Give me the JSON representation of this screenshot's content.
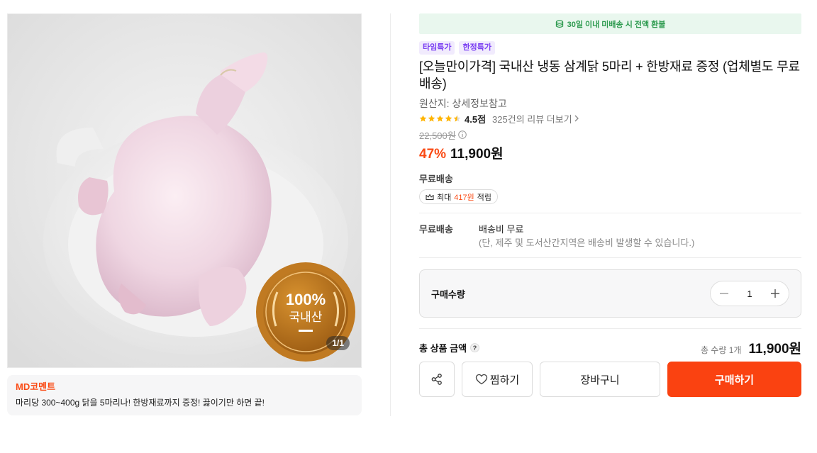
{
  "gallery": {
    "image_label": "product-photo-frozen-whole-chicken",
    "seal_lines": [
      "100%",
      "국내산"
    ],
    "counter": "1/1"
  },
  "md_comment": {
    "title": "MD코멘트",
    "text": "마리당 300~400g 닭을 5마리나! 한방재료까지 증정! 끓이기만 하면 끝!"
  },
  "refund_banner": {
    "icon": "coin-icon",
    "text": "30일 이내 미배송 시 전액 환불",
    "color": "#2c9a4e"
  },
  "badges": [
    "타임특가",
    "한정특가"
  ],
  "product": {
    "title": "[오늘만이가격] 국내산 냉동 삼계닭 5마리 + 한방재료 증정 (업체별도 무료배송)",
    "origin": "원산지: 상세정보참고",
    "rating": {
      "stars": 4.5,
      "score": "4.5점",
      "reviews": "325건의 리뷰 더보기"
    },
    "original_price": "22,500원",
    "discount": "47%",
    "sale_price": "11,900원"
  },
  "shipping": {
    "headline": "무료배송",
    "points": {
      "prefix": "최대",
      "amount": "417원",
      "suffix": "적립"
    },
    "label": "무료배송",
    "fee": "배송비 무료",
    "note": "(단, 제주 및 도서산간지역은 배송비 발생할 수 있습니다.)"
  },
  "quantity": {
    "label": "구매수량",
    "value": "1"
  },
  "total": {
    "label": "총 상품 금액",
    "qty_text": "총 수량 1개",
    "price": "11,900원"
  },
  "actions": {
    "wish_label": "찜하기",
    "cart_label": "장바구니",
    "buy_label": "구매하기"
  },
  "colors": {
    "accent": "#fa4211",
    "badge_text": "#7a3ff2",
    "badge_bg": "#f1ebfd",
    "star": "#ffb400"
  }
}
